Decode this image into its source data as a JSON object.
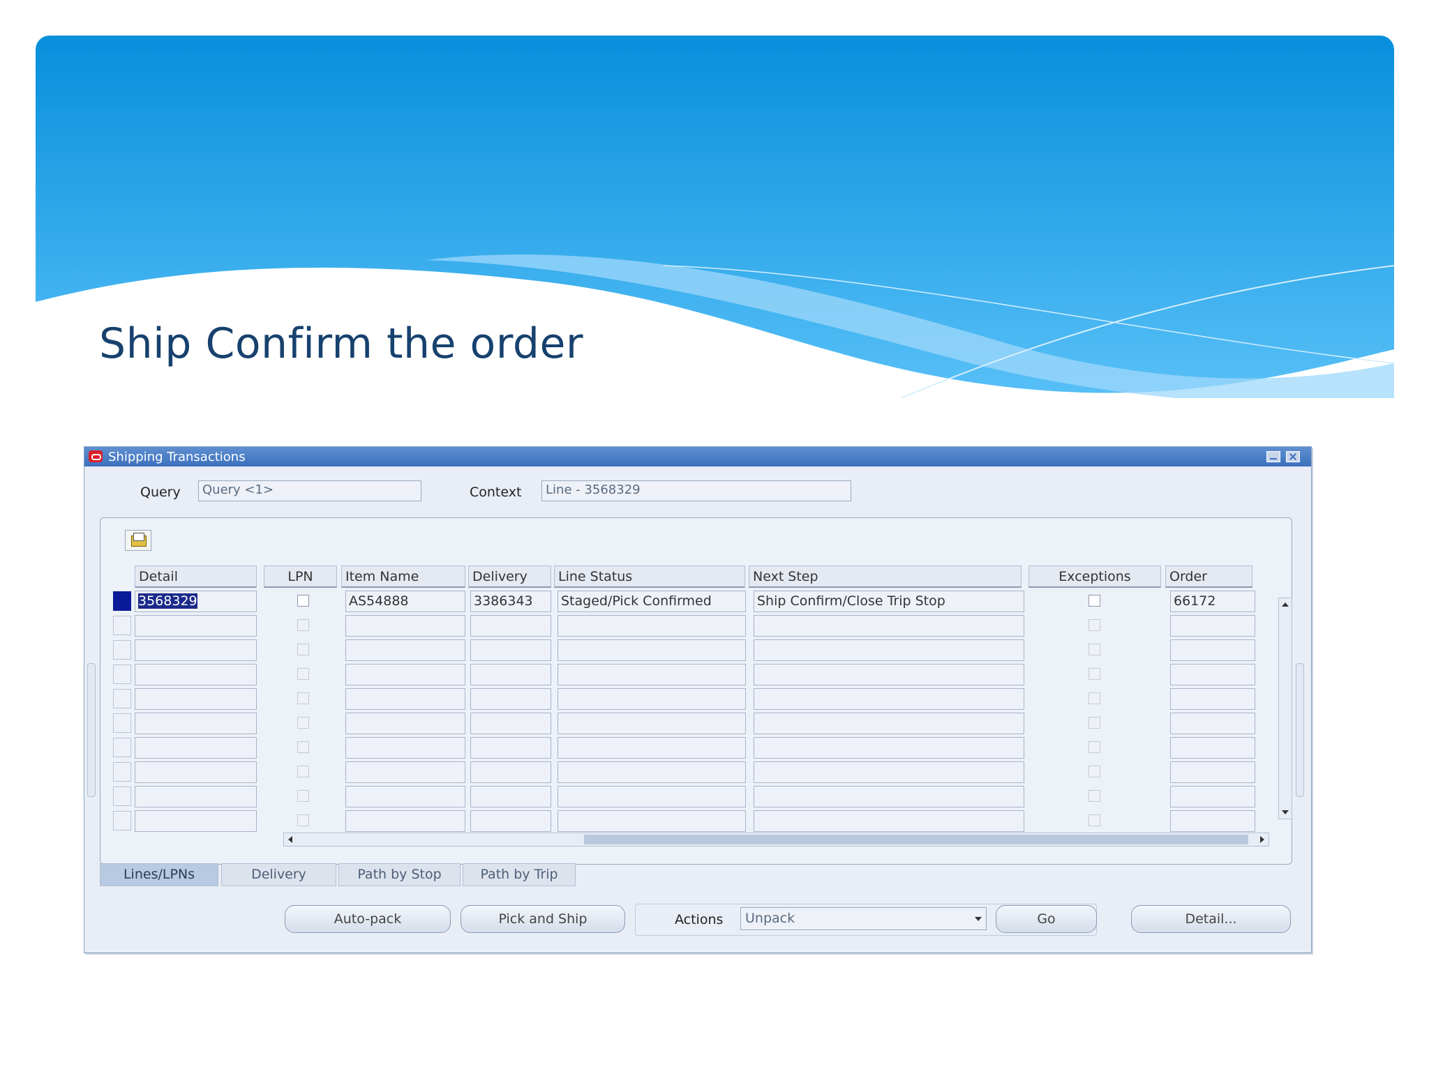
{
  "slide": {
    "title": "Ship Confirm the order"
  },
  "window": {
    "title": "Shipping Transactions"
  },
  "query": {
    "label": "Query",
    "value": "Query <1>"
  },
  "context": {
    "label": "Context",
    "value": "Line - 3568329"
  },
  "table": {
    "columns": [
      "Detail",
      "LPN",
      "Item Name",
      "Delivery",
      "Line Status",
      "Next Step",
      "Exceptions",
      "Order"
    ],
    "rows": [
      {
        "detail": "3568329",
        "item_name": "AS54888",
        "delivery": "3386343",
        "line_status": "Staged/Pick Confirmed",
        "next_step": "Ship Confirm/Close Trip Stop",
        "order": "66172"
      }
    ]
  },
  "tabs": [
    "Lines/LPNs",
    "Delivery",
    "Path by Stop",
    "Path by Trip"
  ],
  "buttons": {
    "auto_pack": "Auto-pack",
    "pick_and_ship": "Pick and Ship",
    "go": "Go",
    "detail": "Detail..."
  },
  "actions": {
    "label": "Actions",
    "selected": "Unpack"
  },
  "colors": {
    "selection": "#0b1a99",
    "title_bar": "#3b70bd",
    "slide_title": "#17416e",
    "banner": "#1a9ae6"
  },
  "icons": [
    "folder-icon",
    "minimize-icon",
    "close-icon",
    "oracle-logo-icon"
  ]
}
